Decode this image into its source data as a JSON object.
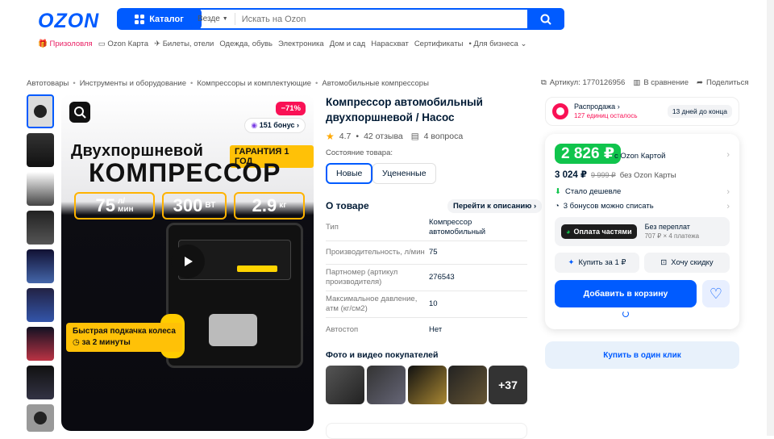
{
  "header": {
    "logo": "OZON",
    "catalog": "Каталог",
    "search_scope": "Везде",
    "search_placeholder": "Искать на Ozon"
  },
  "topnav": [
    "Призоловля",
    "Ozon Карта",
    "Билеты, отели",
    "Одежда, обувь",
    "Электроника",
    "Дом и сад",
    "Нарасхват",
    "Сертификаты",
    "Для бизнеса"
  ],
  "breadcrumbs": [
    "Автотовары",
    "Инструменты и оборудование",
    "Компрессоры и комплектующие",
    "Автомобильные компрессоры"
  ],
  "meta": {
    "article": "Артикул: 1770126956",
    "compare": "В сравнение",
    "share": "Поделиться"
  },
  "image": {
    "discount": "−71%",
    "bonus": "151 бонус",
    "line1": "Двухпоршневой",
    "guarantee": "ГАРАНТИЯ 1 ГОД",
    "line2": "КОМПРЕССОР",
    "spec1": "75",
    "spec1unit_top": "л/",
    "spec1unit_bot": "мин",
    "spec2": "300",
    "spec2unit": "ВТ",
    "spec3": "2.9",
    "spec3unit": "кг",
    "fast1": "Быстрая подкачка колеса",
    "fast2": "за 2 минуты"
  },
  "product": {
    "title": "Компрессор автомобильный двухпоршневой / Насос",
    "rating": "4.7",
    "reviews": "42 отзыва",
    "questions": "4 вопроса",
    "condition_label": "Состояние товара:",
    "cond_new": "Новые",
    "cond_discount": "Уцененные",
    "about": "О товаре",
    "goto": "Перейти к описанию"
  },
  "specs": [
    {
      "k": "Тип",
      "v": "Компрессор автомобильный"
    },
    {
      "k": "Производительность, л/мин",
      "v": "75"
    },
    {
      "k": "Партномер (артикул производителя)",
      "v": "276543"
    },
    {
      "k": "Максимальное давление, атм (кг/см2)",
      "v": "10"
    },
    {
      "k": "Автостоп",
      "v": "Нет"
    }
  ],
  "photos_title": "Фото и видео покупателей",
  "photos_more": "+37",
  "sale": {
    "title": "Распродажа",
    "left": "127 единиц осталось",
    "days": "13 дней до конца"
  },
  "price": {
    "main": "2 826 ₽",
    "with_card": "с Ozon Картой",
    "without": "3 024 ₽",
    "old": "9 999 ₽",
    "without_label": "без Ozon Карты",
    "cheaper": "Стало дешевле",
    "bonus_line": "3 бонусов можно списать",
    "installment_badge": "Оплата частями",
    "inst_title": "Без переплат",
    "inst_sub": "707 ₽ × 4 платежа",
    "buy1": "Купить за 1 ₽",
    "want": "Хочу скидку",
    "cart": "Добавить в корзину",
    "oneclick": "Купить в один клик"
  },
  "colors": {
    "brand": "#005bff",
    "sale": "#f91155",
    "green": "#10c44c",
    "yellow": "#ffc107"
  }
}
